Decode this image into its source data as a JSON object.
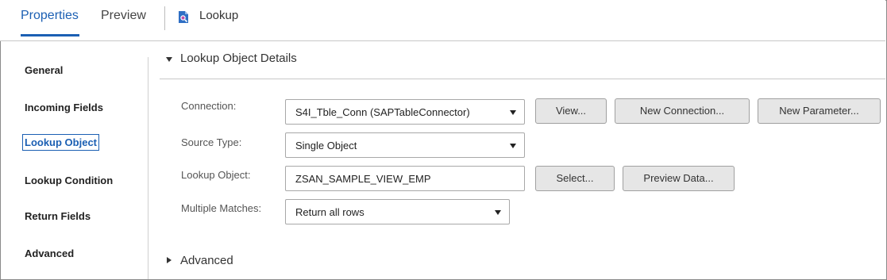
{
  "tabs": {
    "properties": "Properties",
    "preview": "Preview"
  },
  "header": {
    "title": "Lookup",
    "icon": "lookup-transformation-icon"
  },
  "sidebar": {
    "items": [
      {
        "label": "General"
      },
      {
        "label": "Incoming Fields"
      },
      {
        "label": "Lookup Object",
        "active": true
      },
      {
        "label": "Lookup Condition"
      },
      {
        "label": "Return Fields"
      },
      {
        "label": "Advanced"
      }
    ]
  },
  "section": {
    "title": "Lookup Object Details"
  },
  "form": {
    "connection": {
      "label": "Connection:",
      "value": "S4I_Tble_Conn (SAPTableConnector)",
      "view_button": "View...",
      "new_connection_button": "New Connection...",
      "new_parameter_button": "New Parameter..."
    },
    "source_type": {
      "label": "Source Type:",
      "value": "Single Object"
    },
    "lookup_object": {
      "label": "Lookup Object:",
      "value": "ZSAN_SAMPLE_VIEW_EMP",
      "select_button": "Select...",
      "preview_button": "Preview Data..."
    },
    "multiple_matches": {
      "label": "Multiple Matches:",
      "value": "Return all rows"
    }
  },
  "advanced_section": {
    "label": "Advanced"
  },
  "colors": {
    "accent": "#1b5fb3",
    "button_bg": "#e6e6e6",
    "border": "#a8a8a8"
  }
}
